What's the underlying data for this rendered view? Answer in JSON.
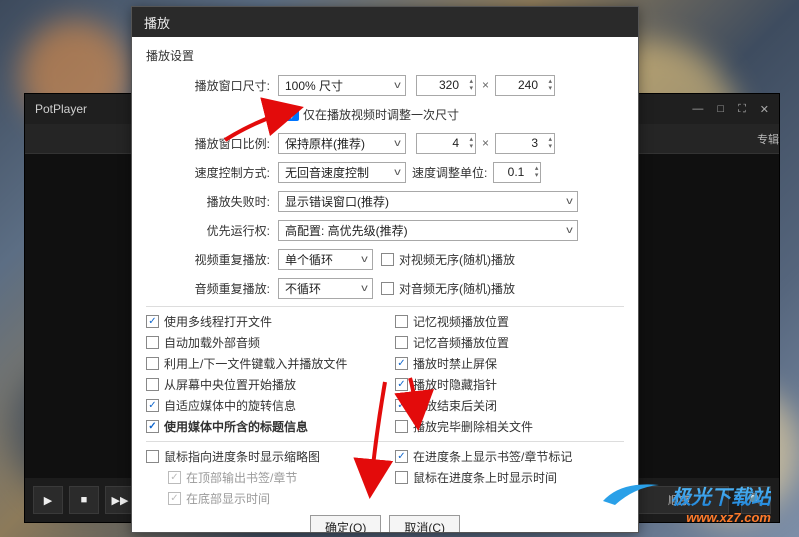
{
  "bg_app": {
    "title": "PotPlayer",
    "winbtns": {
      "min": "—",
      "max": "□",
      "full": "⛶",
      "close": "✕"
    },
    "tab_album": "专辑",
    "bottom_order": "顺序",
    "ctrl": {
      "play": "▶",
      "stop": "■",
      "next": "▶▶"
    },
    "search_icon": "🔍"
  },
  "dlg": {
    "title": "播放",
    "section": "播放设置",
    "rows": {
      "win_size_label": "播放窗口尺寸:",
      "win_size_value": "100% 尺寸",
      "win_size_w": "320",
      "win_size_h": "240",
      "size_once": "仅在播放视频时调整一次尺寸",
      "win_ratio_label": "播放窗口比例:",
      "win_ratio_value": "保持原样(推荐)",
      "win_ratio_a": "4",
      "win_ratio_b": "3",
      "speed_label": "速度控制方式:",
      "speed_value": "无回音速度控制",
      "speed_unit_label": "速度调整单位:",
      "speed_unit_value": "0.1",
      "fail_label": "播放失败时:",
      "fail_value": "显示错误窗口(推荐)",
      "priority_label": "优先运行权:",
      "priority_value": "高配置: 高优先级(推荐)",
      "vloop_label": "视频重复播放:",
      "vloop_value": "单个循环",
      "vloop_shuffle": "对视频无序(随机)播放",
      "aloop_label": "音频重复播放:",
      "aloop_value": "不循环",
      "aloop_shuffle": "对音频无序(随机)播放"
    },
    "left_checks": {
      "c1": "使用多线程打开文件",
      "c2": "自动加载外部音频",
      "c3": "利用上/下一文件键载入并播放文件",
      "c4": "从屏幕中央位置开始播放",
      "c5": "自适应媒体中的旋转信息",
      "c6": "使用媒体中所含的标题信息"
    },
    "right_checks": {
      "c1": "记忆视频播放位置",
      "c2": "记忆音频播放位置",
      "c3": "播放时禁止屏保",
      "c4": "播放时隐藏指针",
      "c5": "播放结束后关闭",
      "c6": "播放完毕删除相关文件"
    },
    "bottom_left": {
      "thumb": "鼠标指向进度条时显示缩略图",
      "top_out": "在顶部输出书签/章节",
      "bottom_time": "在底部显示时间"
    },
    "bottom_right": {
      "show_mark": "在进度条上显示书签/章节标记",
      "hover_time": "鼠标在进度条上时显示时间"
    },
    "buttons": {
      "ok": "确定(O)",
      "cancel": "取消(C)"
    }
  },
  "watermark": {
    "l1": "极光下载站",
    "l2": "www.xz7.com"
  }
}
